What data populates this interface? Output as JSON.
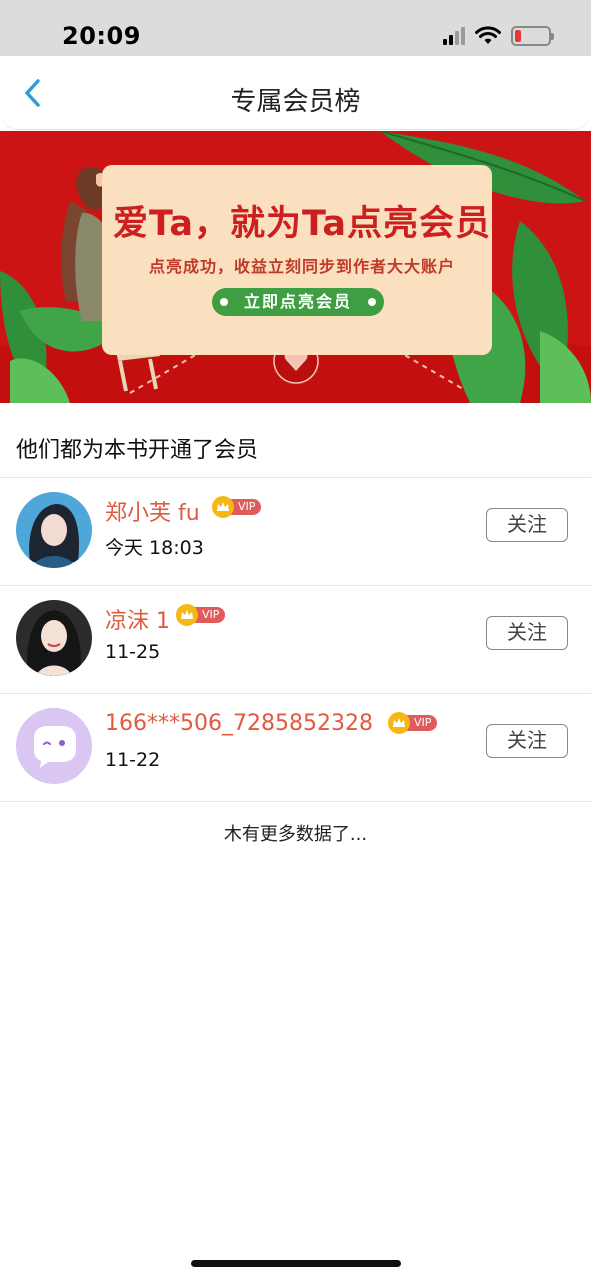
{
  "status_bar": {
    "time": "20:09",
    "icons": [
      "signal-icon",
      "wifi-icon",
      "battery-low-icon"
    ],
    "battery_color": "#e53935"
  },
  "nav": {
    "title": "专属会员榜",
    "back_icon": "chevron-left-icon",
    "accent_color": "#2d9cdb"
  },
  "banner": {
    "headline": "爱Ta，就为Ta点亮会员",
    "subtitle": "点亮成功，收益立刻同步到作者大大账户",
    "cta_label": "立即点亮会员",
    "bg_color": "#cc1414",
    "card_color": "#fbe0bf",
    "cta_color": "#3f9d42"
  },
  "section": {
    "title": "他们都为本书开通了会员"
  },
  "members": [
    {
      "name": "郑小芙 fu",
      "vip": "VIP",
      "time": "今天 18:03",
      "follow_label": "关注",
      "avatar": "photo-avatar"
    },
    {
      "name": "凉沫 1",
      "vip": "VIP",
      "time": "11-25",
      "follow_label": "关注",
      "avatar": "photo-avatar"
    },
    {
      "name": "166***506_7285852328",
      "vip": "VIP",
      "time": "11-22",
      "follow_label": "关注",
      "avatar": "default-chat-avatar"
    }
  ],
  "footer": {
    "no_more_text": "木有更多数据了..."
  },
  "colors": {
    "name_color": "#e05a3f",
    "vip_badge_color": "#e25b5b",
    "crown_color": "#f5b814"
  }
}
